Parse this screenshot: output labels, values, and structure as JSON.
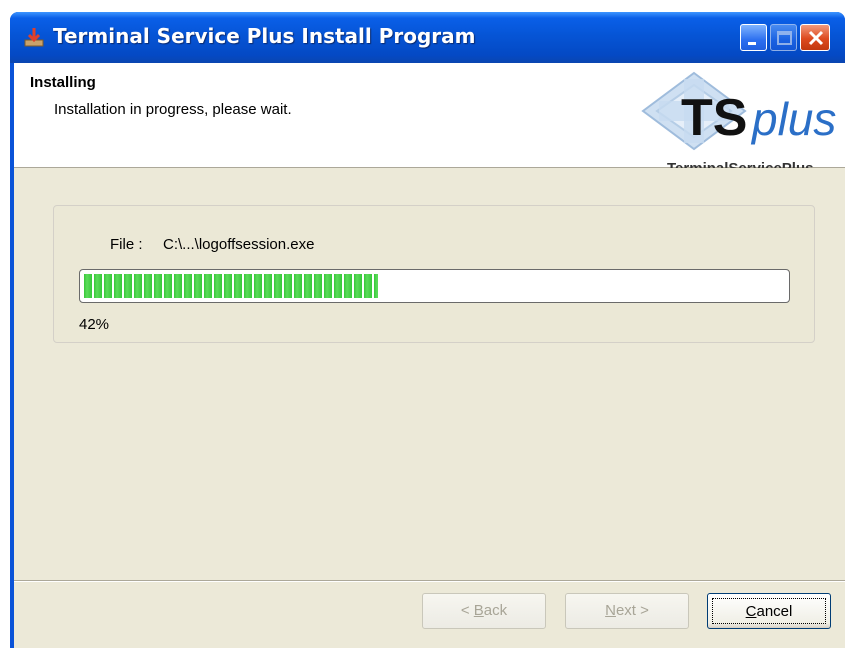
{
  "window": {
    "title": "Terminal Service Plus Install Program"
  },
  "header": {
    "title": "Installing",
    "subtitle": "Installation in progress, please wait.",
    "logo": {
      "brand_main": "TS",
      "brand_accent": "plus",
      "tagline": "TerminalServicePlus"
    }
  },
  "progress": {
    "file_label": "File :",
    "file_name": "C:\\...\\logoffsession.exe",
    "value": 0.42,
    "percent_text": "42%"
  },
  "buttons": {
    "back": {
      "mnemonic": "B",
      "rest": "ack",
      "prefix": "< "
    },
    "next": {
      "mnemonic": "N",
      "rest": "ext >"
    },
    "cancel": {
      "mnemonic": "C",
      "rest": "ancel"
    }
  },
  "colors": {
    "titlebar": "#0655d6",
    "progress_fill": "#37c83a",
    "logo_accent": "#2b6fc7"
  },
  "icons": {
    "app": "installer-icon",
    "minimize": "minimize-icon",
    "maximize": "maximize-icon",
    "close": "close-icon"
  }
}
